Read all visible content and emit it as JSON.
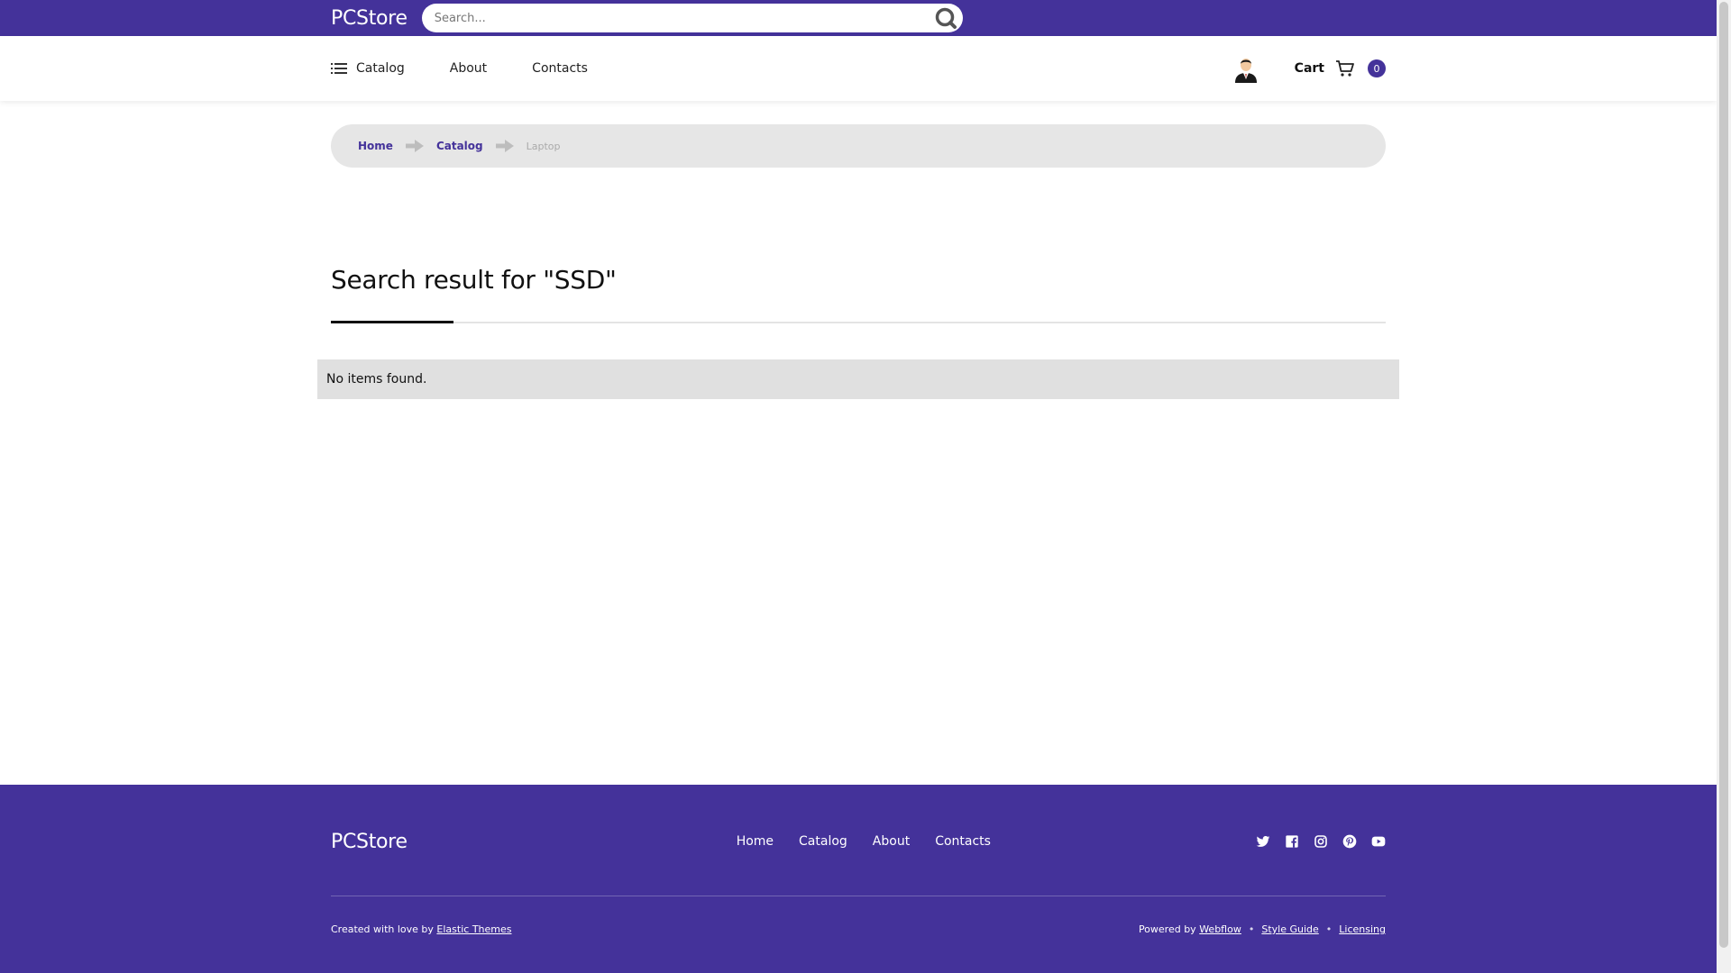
{
  "header": {
    "brand": "PCStore",
    "search_placeholder": "Search..."
  },
  "nav": {
    "catalog": "Catalog",
    "about": "About",
    "contacts": "Contacts",
    "cart_label": "Cart",
    "cart_count": "0"
  },
  "breadcrumb": {
    "home": "Home",
    "catalog": "Catalog",
    "current": "Laptop"
  },
  "main": {
    "heading": "Search result for \"SSD\"",
    "empty_message": "No items found."
  },
  "footer": {
    "brand": "PCStore",
    "links": [
      "Home",
      "Catalog",
      "About",
      "Contacts"
    ],
    "credit_prefix": "Created with love by",
    "credit_link": "Elastic Themes",
    "powered_prefix": "Powered by",
    "powered_link": "Webflow",
    "style_guide": "Style Guide",
    "licensing": "Licensing",
    "social_icons": [
      "twitter-icon",
      "facebook-icon",
      "instagram-icon",
      "pinterest-icon",
      "youtube-icon"
    ]
  },
  "colors": {
    "brand": "#44329a",
    "breadcrumb_bg": "#e6e6e6",
    "empty_bg": "#e0e0e0"
  }
}
